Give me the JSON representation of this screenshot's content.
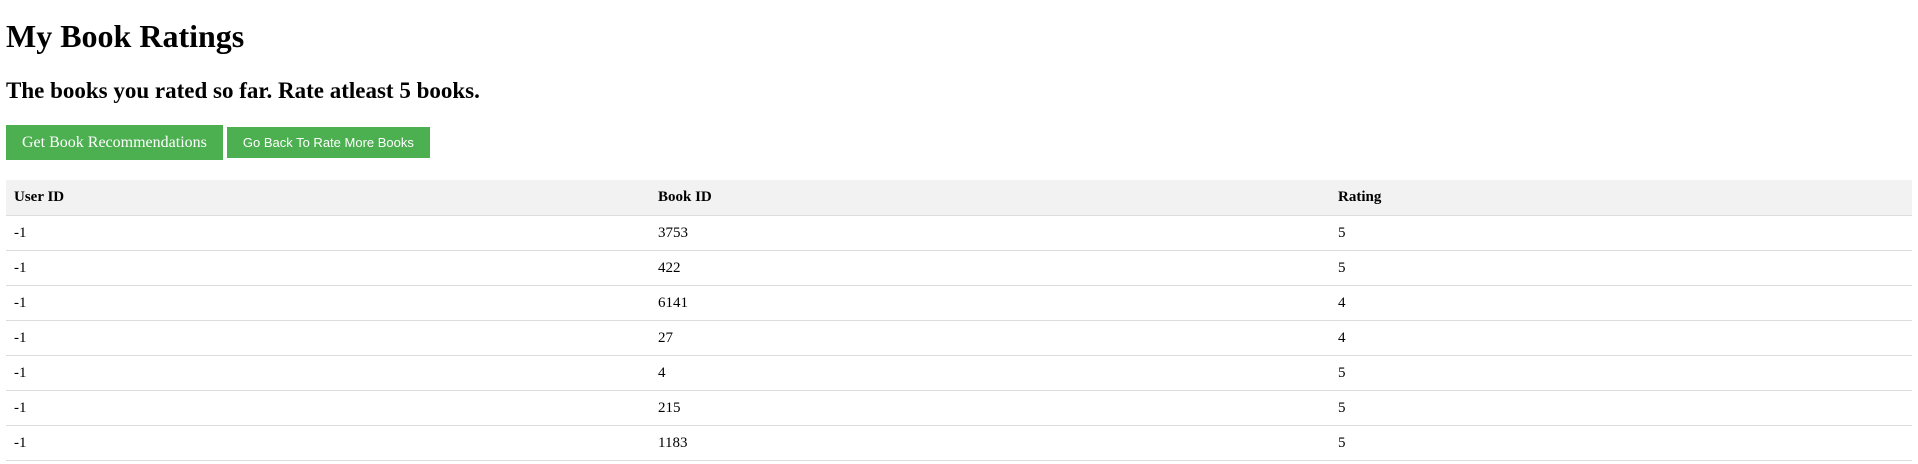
{
  "page": {
    "title": "My Book Ratings",
    "subtitle": "The books you rated so far. Rate atleast 5 books."
  },
  "actions": {
    "recommend_label": "Get Book Recommendations",
    "back_label": "Go Back To Rate More Books"
  },
  "colors": {
    "button_bg": "#4caf50",
    "header_bg": "#f2f2f2",
    "row_border": "#dddddd"
  },
  "table": {
    "headers": [
      "User ID",
      "Book ID",
      "Rating"
    ],
    "rows": [
      [
        "-1",
        "3753",
        "5"
      ],
      [
        "-1",
        "422",
        "5"
      ],
      [
        "-1",
        "6141",
        "4"
      ],
      [
        "-1",
        "27",
        "4"
      ],
      [
        "-1",
        "4",
        "5"
      ],
      [
        "-1",
        "215",
        "5"
      ],
      [
        "-1",
        "1183",
        "5"
      ]
    ]
  }
}
